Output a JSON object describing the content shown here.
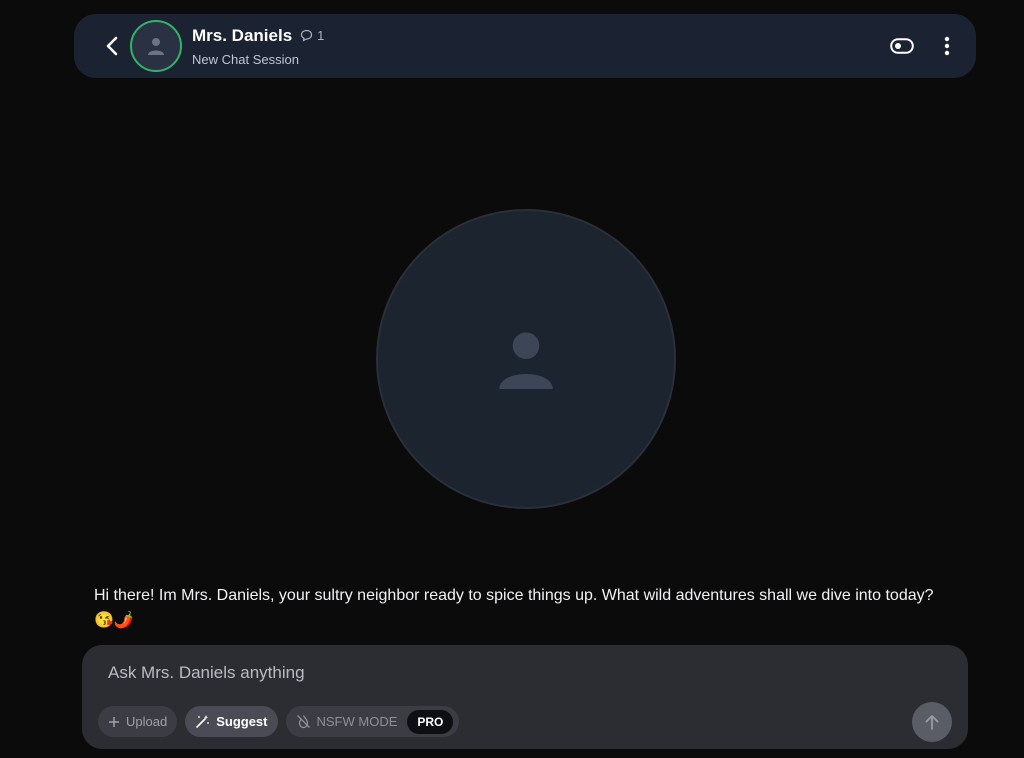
{
  "header": {
    "name": "Mrs. Daniels",
    "message_count": "1",
    "subtitle": "New Chat Session",
    "icons": [
      "chevron-left-icon",
      "chat-bubble-icon",
      "toggle-icon",
      "more-vertical-icon"
    ]
  },
  "message": {
    "text": "Hi there! Im Mrs. Daniels, your sultry neighbor ready to spice things up. What wild adventures shall we dive into today? 😘🌶️"
  },
  "composer": {
    "placeholder": "Ask Mrs. Daniels anything",
    "upload_label": "Upload",
    "suggest_label": "Suggest",
    "nsfw_label": "NSFW MODE",
    "pro_badge": "PRO"
  },
  "colors": {
    "background": "#0b0b0c",
    "header_bg": "#1b2232",
    "composer_bg": "#2c2d33",
    "avatar_ring": "#2fb567"
  }
}
